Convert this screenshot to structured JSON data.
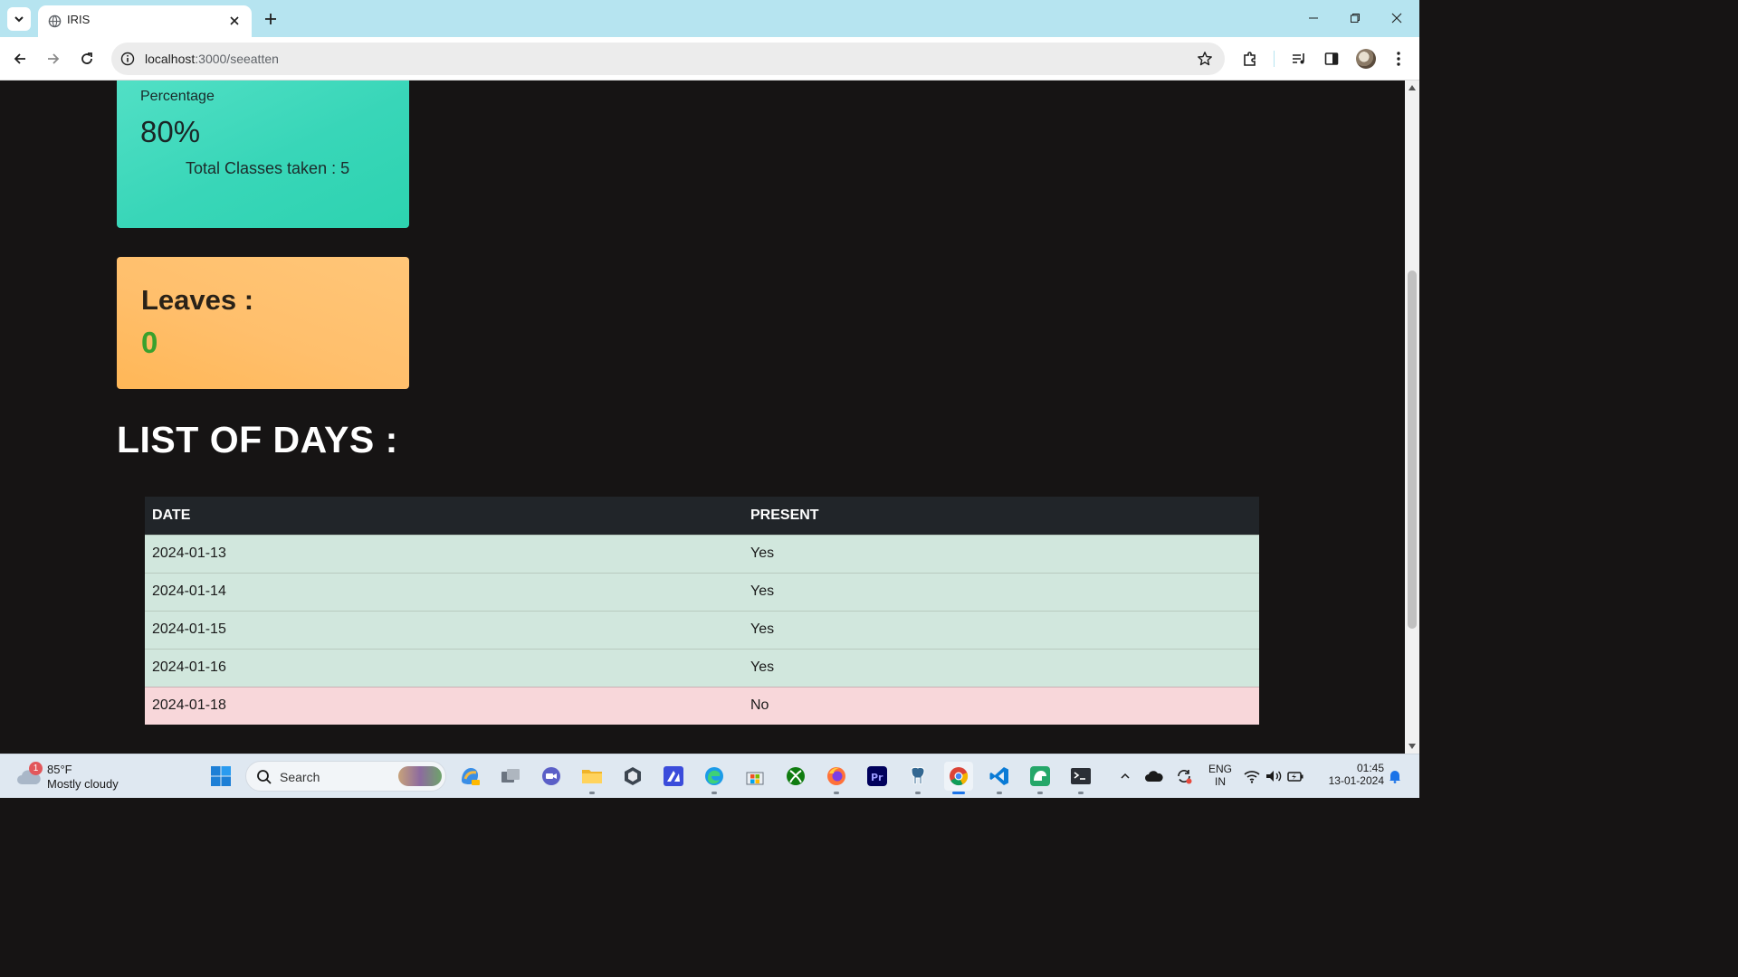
{
  "browser": {
    "tab_title": "IRIS",
    "url_host": "localhost",
    "url_path": ":3000/seeatten"
  },
  "page": {
    "percentage_card": {
      "label": "Percentage",
      "value": "80%",
      "total_classes": "Total Classes taken : 5"
    },
    "leaves_card": {
      "label": "Leaves :",
      "value": "0"
    },
    "list_heading": "LIST OF DAYS :",
    "table": {
      "headers": [
        "DATE",
        "PRESENT"
      ],
      "rows": [
        {
          "date": "2024-01-13",
          "present": "Yes"
        },
        {
          "date": "2024-01-14",
          "present": "Yes"
        },
        {
          "date": "2024-01-15",
          "present": "Yes"
        },
        {
          "date": "2024-01-16",
          "present": "Yes"
        },
        {
          "date": "2024-01-18",
          "present": "No"
        }
      ]
    }
  },
  "taskbar": {
    "weather_temp": "85°F",
    "weather_desc": "Mostly cloudy",
    "weather_badge": "1",
    "search_label": "Search",
    "lang_top": "ENG",
    "lang_bottom": "IN",
    "time": "01:45",
    "date": "13-01-2024"
  },
  "colors": {
    "percentage_card": "#3dd9bb",
    "leaves_card": "#ffbf6c",
    "leaves_value": "#3aa12d",
    "present_row": "#d1e7dd",
    "absent_row": "#f8d7da",
    "table_header": "#212529",
    "page_bg": "#161414"
  },
  "icons": {
    "tab_list": "chevron-down-icon",
    "favicon": "globe-icon",
    "tab_close": "close-icon",
    "new_tab": "plus-icon",
    "back": "arrow-left-icon",
    "forward": "arrow-right-icon",
    "reload": "reload-icon",
    "site_info": "info-icon",
    "bookmark": "star-icon",
    "extensions": "puzzle-icon",
    "media": "media-control-icon",
    "side_panel": "side-panel-icon",
    "menu": "kebab-menu-icon"
  }
}
